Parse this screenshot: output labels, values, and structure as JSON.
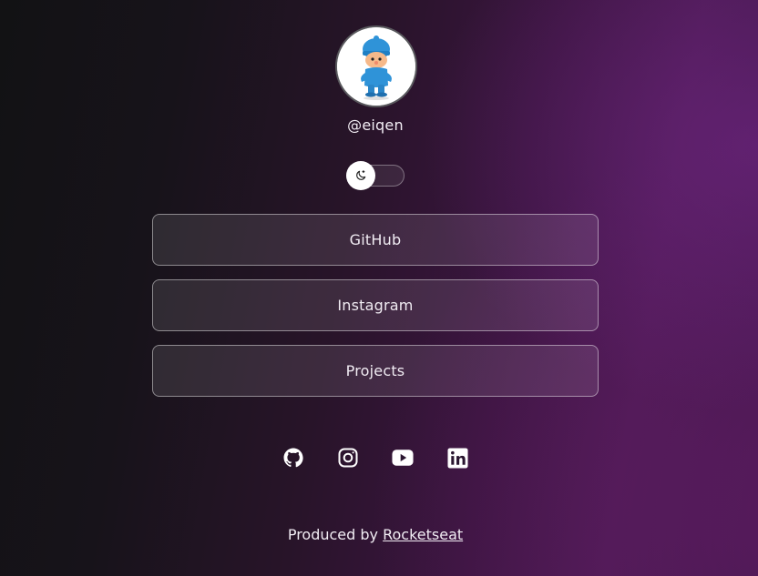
{
  "profile": {
    "username": "@eiqen",
    "avatar_icon": "pocoyo-avatar-icon"
  },
  "theme_toggle": {
    "icon": "moon-icon",
    "state": "dark"
  },
  "links": [
    {
      "label": "GitHub"
    },
    {
      "label": "Instagram"
    },
    {
      "label": "Projects"
    }
  ],
  "socials": [
    {
      "icon": "github-icon"
    },
    {
      "icon": "instagram-icon"
    },
    {
      "icon": "youtube-icon"
    },
    {
      "icon": "linkedin-icon"
    }
  ],
  "footer": {
    "prefix": "Produced by ",
    "link_label": "Rocketseat"
  },
  "colors": {
    "background_start": "#121214",
    "background_end": "#4a1a52",
    "text": "#f4f0f6"
  }
}
